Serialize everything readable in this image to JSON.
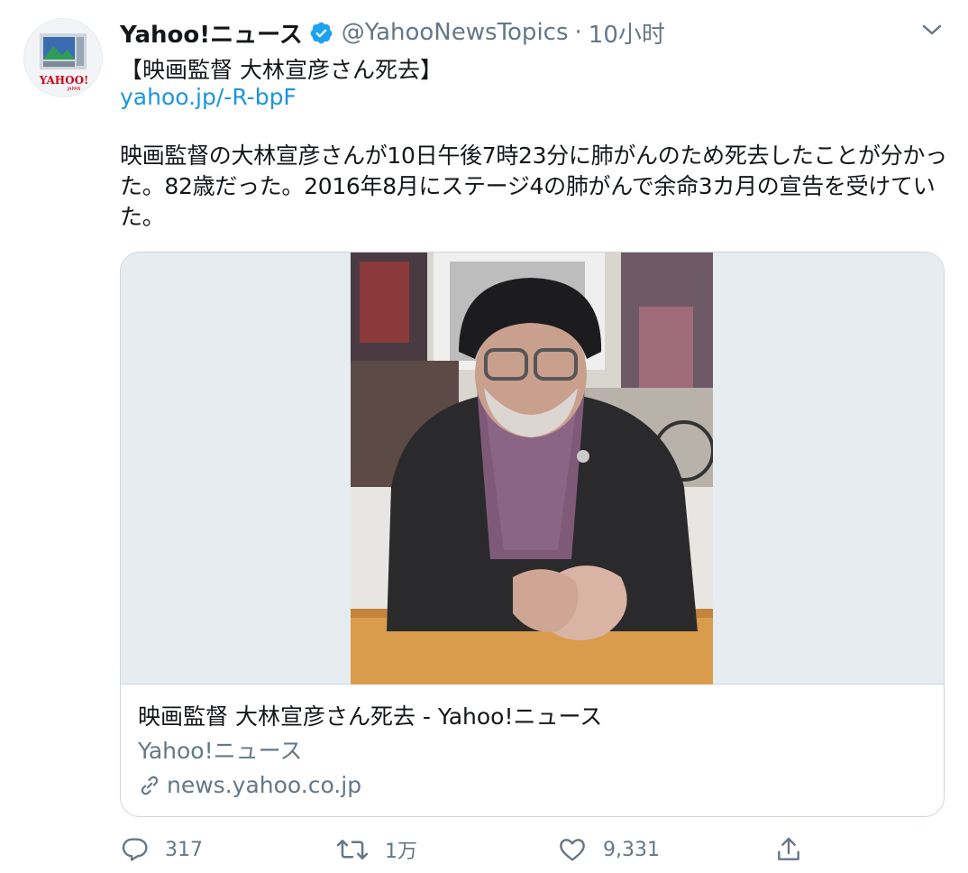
{
  "author": {
    "name": "Yahoo!ニュース",
    "handle": "@YahooNewsTopics",
    "separator": "·",
    "time": "10小时",
    "avatar_logo_text": "YAHOO!",
    "avatar_logo_subtext": "JAPAN",
    "verified": true
  },
  "tweet": {
    "headline": "【映画監督 大林宣彦さん死去】",
    "link": "yahoo.jp/-R-bpF",
    "body": "映画監督の大林宣彦さんが10日午後7時23分に肺がんのため死去したことが分かった。82歳だった。2016年8月にステージ4の肺がんで余命3カ月の宣告を受けていた。"
  },
  "card": {
    "title": "映画監督 大林宣彦さん死去 - Yahoo!ニュース",
    "description": "Yahoo!ニュース",
    "domain": "news.yahoo.co.jp"
  },
  "actions": {
    "reply_count": "317",
    "retweet_count": "1万",
    "like_count": "9,331"
  },
  "colors": {
    "link": "#1b95e0",
    "secondary_text": "#657786",
    "verified_badge": "#1da1f2",
    "border": "#ccd6dd",
    "media_background": "#e6ecf0"
  },
  "icons": [
    "verified-badge-icon",
    "chevron-down-icon",
    "link-icon",
    "reply-icon",
    "retweet-icon",
    "like-icon",
    "share-icon"
  ]
}
